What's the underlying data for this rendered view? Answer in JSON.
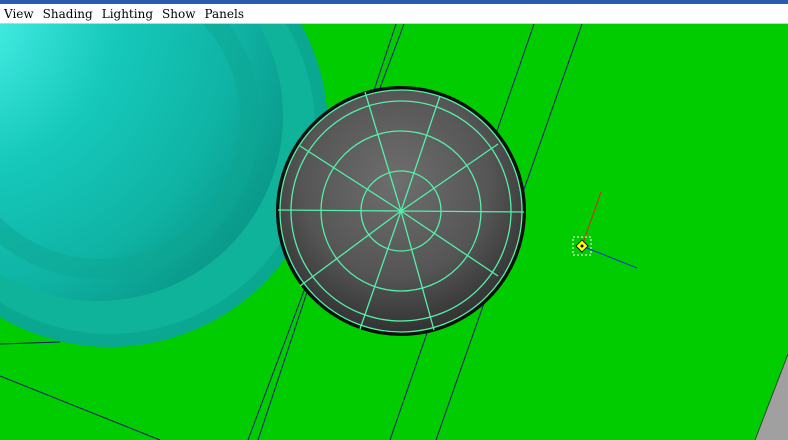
{
  "menubar": {
    "items": [
      {
        "label": "View"
      },
      {
        "label": "Shading"
      },
      {
        "label": "Lighting"
      },
      {
        "label": "Show"
      },
      {
        "label": "Panels"
      }
    ]
  },
  "viewport": {
    "background_color": "#00cc00",
    "large_sphere": {
      "color": "#14c8b8",
      "rim_color": "#0aa890"
    },
    "selected_sphere": {
      "color": "#5a5a5a",
      "wireframe_color": "#55f0a8",
      "selected": true
    },
    "locator": {
      "icon": "locator-icon",
      "x_axis_color": "#e02020",
      "y_axis_color": "#1a2fd0",
      "handle_color": "#ffff00"
    },
    "ground_plane_edge_color": "#a0a0a0",
    "construction_line_color": "#1a1a6a"
  }
}
